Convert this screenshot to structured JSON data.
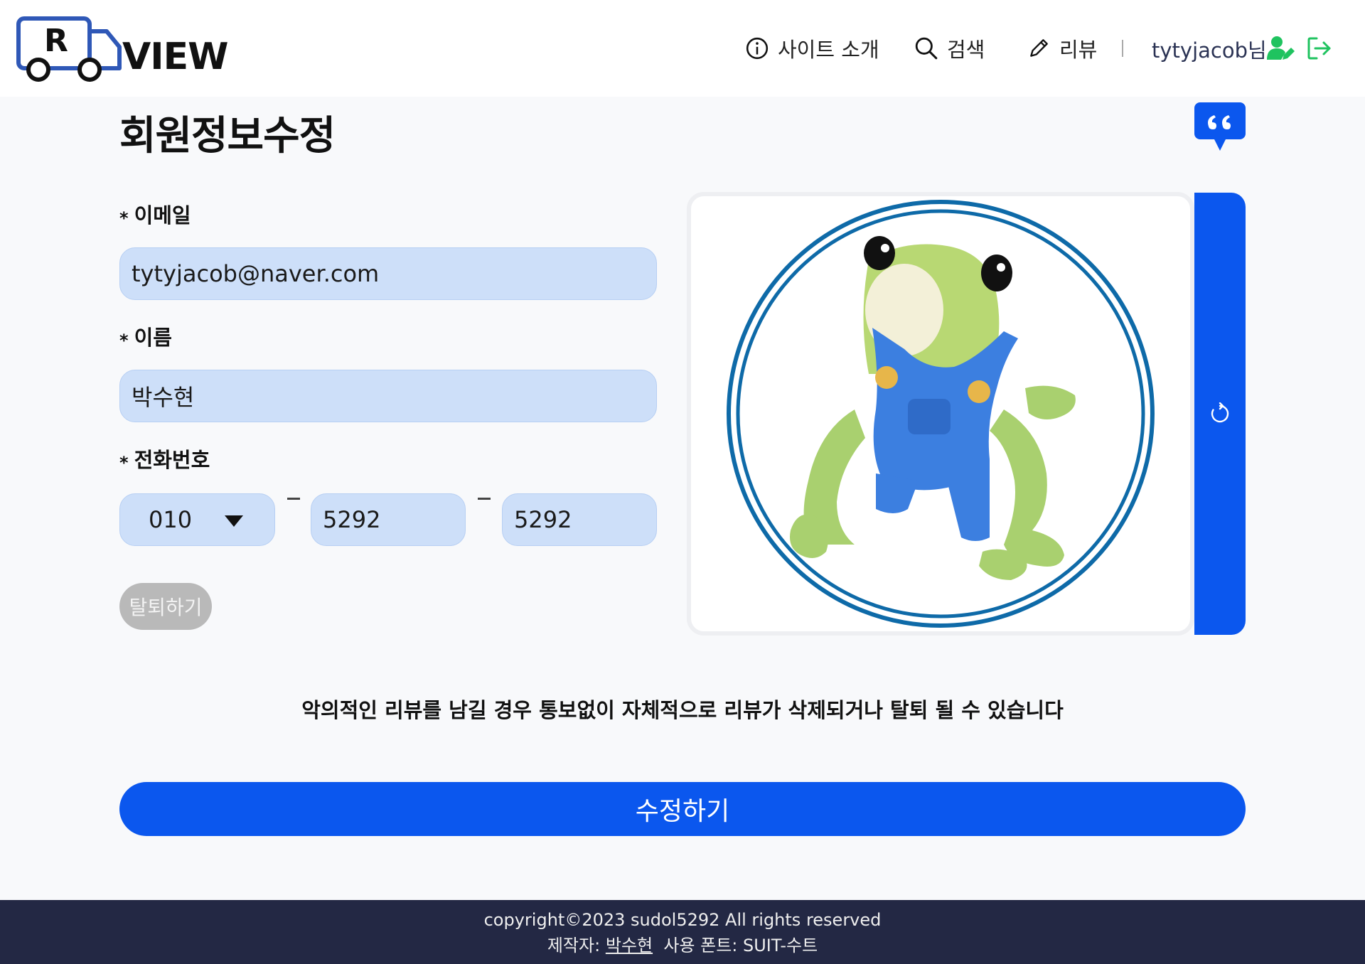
{
  "header": {
    "logo_letter": "R",
    "logo_text": "VIEW",
    "nav": [
      {
        "label": "사이트 소개",
        "icon": "info-icon"
      },
      {
        "label": "검색",
        "icon": "search-icon"
      },
      {
        "label": "리뷰",
        "icon": "pencil-icon"
      }
    ],
    "user_label": "tytyjacob님",
    "user_icon": "user-edit-icon",
    "logout_icon": "logout-icon",
    "accent_green": "#1fc35f"
  },
  "page": {
    "title": "회원정보수정",
    "quote_icon": "quote-bubble-icon"
  },
  "form": {
    "required_mark": "*",
    "email_label": "이메일",
    "email_value": "tytyjacob@naver.com",
    "name_label": "이름",
    "name_value": "박수현",
    "phone_label": "전화번호",
    "phone_prefix": "010",
    "phone_middle": "5292",
    "phone_last": "5292",
    "withdraw_label": "탈퇴하기"
  },
  "profile": {
    "image_alt": "frog-in-overalls-avatar",
    "refresh_icon": "refresh-icon"
  },
  "notice": "악의적인 리뷰를 남길 경우 통보없이 자체적으로 리뷰가 삭제되거나 탈퇴 될 수 있습니다",
  "submit_label": "수정하기",
  "footer": {
    "copyright": "copyright©2023 sudol5292 All rights reserved",
    "maker_prefix": "제작자:",
    "maker_name": "박수현",
    "font_info": "사용 폰트: SUIT-수트"
  },
  "colors": {
    "primary": "#0b57ee",
    "field_bg": "#cddff9",
    "footer_bg": "#232844"
  }
}
